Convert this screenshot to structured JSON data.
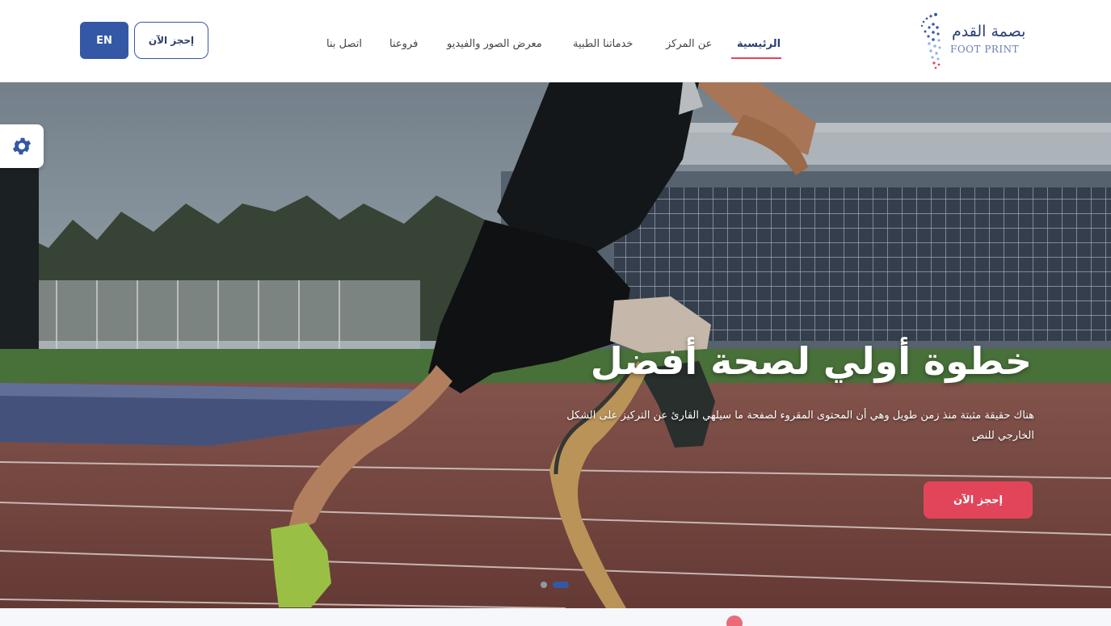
{
  "header": {
    "lang_button": "EN",
    "book_button": "إحجز الآن",
    "logo": {
      "name_ar": "بصمة القدم",
      "name_en": "FOOT PRINT"
    },
    "nav": [
      {
        "label": "الرئيسية",
        "active": true
      },
      {
        "label": "عن المركز",
        "active": false
      },
      {
        "label": "خدماتنا الطبية",
        "active": false
      },
      {
        "label": "معرض الصور والفيديو",
        "active": false
      },
      {
        "label": "فروعنا",
        "active": false
      },
      {
        "label": "اتصل بنا",
        "active": false
      }
    ]
  },
  "hero": {
    "title": "خطوة أولي لصحة أفضل",
    "text": "هناك حقيقة مثبتة منذ زمن طويل وهي أن المحتوى المقروء لصفحة ما سيلهي القارئ عن التركيز على الشكل الخارجي للنص",
    "cta": "إحجز الآن",
    "slides": {
      "count": 2,
      "active": 2
    }
  },
  "widgets": {
    "settings_icon": "gear-icon"
  },
  "colors": {
    "primary": "#3458a6",
    "accent": "#e2455a",
    "nav_text": "#444444"
  }
}
